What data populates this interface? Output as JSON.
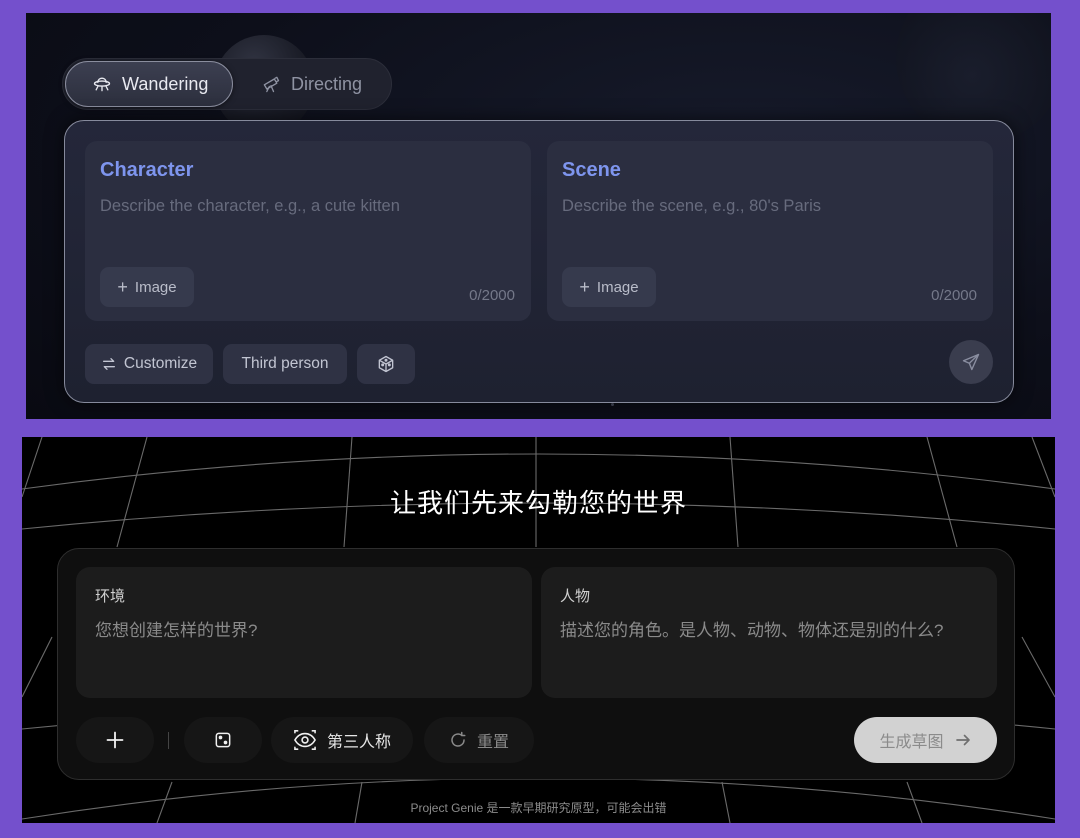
{
  "top": {
    "modes": [
      {
        "label": "Wandering",
        "icon": "ufo-icon",
        "active": true
      },
      {
        "label": "Directing",
        "icon": "telescope-icon",
        "active": false
      }
    ],
    "character": {
      "title": "Character",
      "placeholder": "Describe the character, e.g., a cute kitten",
      "image_label": "Image",
      "counter": "0/2000"
    },
    "scene": {
      "title": "Scene",
      "placeholder": "Describe the scene, e.g., 80's Paris",
      "image_label": "Image",
      "counter": "0/2000"
    },
    "toolbar": {
      "customize_label": "Customize",
      "perspective_label": "Third person",
      "dice_icon": "cube-dice-icon",
      "send_icon": "paper-plane-icon"
    },
    "colors": {
      "accent": "#7e95ee",
      "panel_bg": "#0d0f1a"
    }
  },
  "bottom": {
    "heading": "让我们先来勾勒您的世界",
    "environment": {
      "title": "环境",
      "placeholder": "您想创建怎样的世界?"
    },
    "character": {
      "title": "人物",
      "placeholder": "描述您的角色。是人物、动物、物体还是别的什么?"
    },
    "toolbar": {
      "add_icon": "plus-icon",
      "dice_icon": "dice-icon",
      "perspective_icon": "eye-icon",
      "perspective_label": "第三人称",
      "reset_icon": "refresh-icon",
      "reset_label": "重置",
      "generate_label": "生成草图",
      "generate_icon": "arrow-right-icon"
    },
    "footer": "Project Genie 是一款早期研究原型，可能会出错"
  },
  "colors": {
    "frame": "#7450cc"
  }
}
